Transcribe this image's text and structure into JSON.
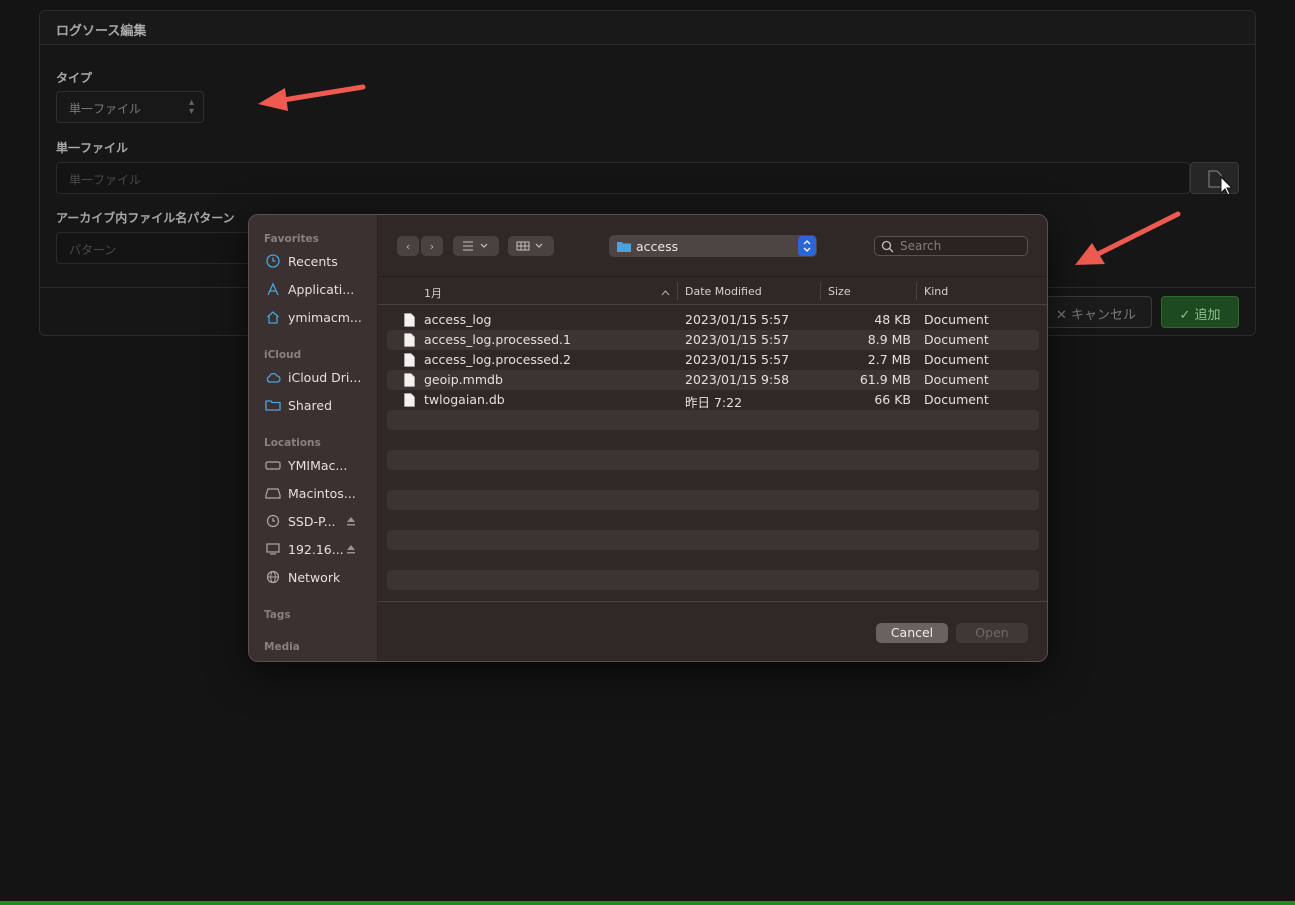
{
  "form": {
    "title": "ログソース編集",
    "type_label": "タイプ",
    "type_value": "単一ファイル",
    "file_label": "単一ファイル",
    "file_placeholder": "単一ファイル",
    "pattern_label": "アーカイブ内ファイル名パターン",
    "pattern_placeholder": "パターン",
    "cancel_label": "キャンセル",
    "add_label": "追加"
  },
  "colors": {
    "annotation_arrow": "#ee5a50",
    "accent_green": "#1f8a2a",
    "folder_blue": "#4aa3df",
    "stepper_blue": "#2b66d6"
  },
  "dialog": {
    "sidebar": {
      "favorites_label": "Favorites",
      "favorites": [
        {
          "label": "Recents",
          "icon": "clock-icon"
        },
        {
          "label": "Applicati...",
          "icon": "applications-icon"
        },
        {
          "label": "ymimacm...",
          "icon": "home-icon"
        }
      ],
      "icloud_label": "iCloud",
      "icloud": [
        {
          "label": "iCloud Dri...",
          "icon": "cloud-icon"
        },
        {
          "label": "Shared",
          "icon": "shared-folder-icon"
        }
      ],
      "locations_label": "Locations",
      "locations": [
        {
          "label": "YMIMac...",
          "icon": "drive-icon"
        },
        {
          "label": "Macintos...",
          "icon": "disk-icon"
        },
        {
          "label": "SSD-P...",
          "icon": "time-machine-icon"
        },
        {
          "label": "192.16...",
          "icon": "monitor-icon"
        },
        {
          "label": "Network",
          "icon": "globe-icon"
        }
      ],
      "tags_label": "Tags",
      "media_label": "Media"
    },
    "toolbar": {
      "current_folder": "access",
      "search_placeholder": "Search"
    },
    "columns": {
      "name": "1月",
      "date": "Date Modified",
      "size": "Size",
      "kind": "Kind"
    },
    "files": [
      {
        "name": "access_log",
        "date": "2023/01/15 5:57",
        "size": "48 KB",
        "kind": "Document"
      },
      {
        "name": "access_log.processed.1",
        "date": "2023/01/15 5:57",
        "size": "8.9 MB",
        "kind": "Document"
      },
      {
        "name": "access_log.processed.2",
        "date": "2023/01/15 5:57",
        "size": "2.7 MB",
        "kind": "Document"
      },
      {
        "name": "geoip.mmdb",
        "date": "2023/01/15 9:58",
        "size": "61.9 MB",
        "kind": "Document"
      },
      {
        "name": "twlogaian.db",
        "date": "昨日 7:22",
        "size": "66 KB",
        "kind": "Document"
      }
    ],
    "cancel_label": "Cancel",
    "open_label": "Open"
  }
}
